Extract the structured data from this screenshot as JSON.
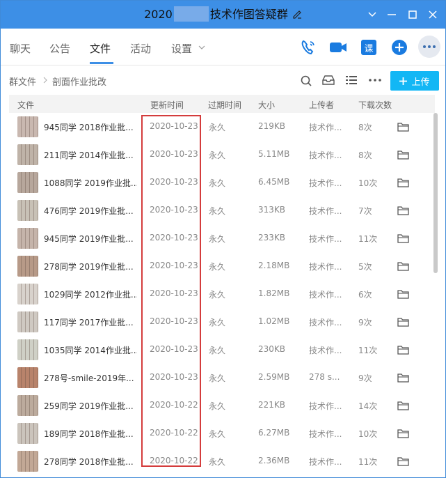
{
  "window": {
    "title_prefix": "2020",
    "title_suffix": "技术作图答疑群"
  },
  "tabs": [
    {
      "label": "聊天"
    },
    {
      "label": "公告"
    },
    {
      "label": "文件"
    },
    {
      "label": "活动"
    },
    {
      "label": "设置"
    }
  ],
  "toolbar": {
    "course_label": "课"
  },
  "breadcrumb": {
    "root": "群文件",
    "current": "剖面作业批改"
  },
  "upload": {
    "label": "上传"
  },
  "columns": {
    "file": "文件",
    "updated": "更新时间",
    "expires": "过期时间",
    "size": "大小",
    "uploader": "上传者",
    "downloads": "下载次数"
  },
  "files": [
    {
      "name": "945同学 2018作业批...",
      "updated": "2020-10-23",
      "expires": "永久",
      "size": "219KB",
      "uploader": "技术作...",
      "downloads": "8次"
    },
    {
      "name": "211同学 2014作业批...",
      "updated": "2020-10-23",
      "expires": "永久",
      "size": "5.11MB",
      "uploader": "技术作...",
      "downloads": "8次"
    },
    {
      "name": "1088同学 2019作业批...",
      "updated": "2020-10-23",
      "expires": "永久",
      "size": "6.45MB",
      "uploader": "技术作...",
      "downloads": "10次"
    },
    {
      "name": "476同学 2019作业批...",
      "updated": "2020-10-23",
      "expires": "永久",
      "size": "313KB",
      "uploader": "技术作...",
      "downloads": "7次"
    },
    {
      "name": "945同学 2019作业批...",
      "updated": "2020-10-23",
      "expires": "永久",
      "size": "233KB",
      "uploader": "技术作...",
      "downloads": "11次"
    },
    {
      "name": "278同学 2019作业批...",
      "updated": "2020-10-23",
      "expires": "永久",
      "size": "2.18MB",
      "uploader": "技术作...",
      "downloads": "5次"
    },
    {
      "name": "1029同学 2012作业批...",
      "updated": "2020-10-23",
      "expires": "永久",
      "size": "1.82MB",
      "uploader": "技术作...",
      "downloads": "6次"
    },
    {
      "name": "117同学 2017作业批...",
      "updated": "2020-10-23",
      "expires": "永久",
      "size": "1.02MB",
      "uploader": "技术作...",
      "downloads": "9次"
    },
    {
      "name": "1035同学 2014作业批...",
      "updated": "2020-10-23",
      "expires": "永久",
      "size": "230KB",
      "uploader": "技术作...",
      "downloads": "11次"
    },
    {
      "name": "278号-smile-2019年...",
      "updated": "2020-10-23",
      "expires": "永久",
      "size": "2.59MB",
      "uploader": "278 s...",
      "downloads": "9次"
    },
    {
      "name": "259同学 2019作业批...",
      "updated": "2020-10-22",
      "expires": "永久",
      "size": "221KB",
      "uploader": "技术作...",
      "downloads": "14次"
    },
    {
      "name": "189同学 2018作业批...",
      "updated": "2020-10-22",
      "expires": "永久",
      "size": "6.27MB",
      "uploader": "技术作...",
      "downloads": "10次"
    },
    {
      "name": "278同学 2018作业批...",
      "updated": "2020-10-22",
      "expires": "永久",
      "size": "2.36MB",
      "uploader": "技术作...",
      "downloads": "11次"
    }
  ],
  "thumb_colors": [
    "#c9b8b0",
    "#bfb3a8",
    "#b7a79c",
    "#c8c1b6",
    "#c5b4aa",
    "#b79a88",
    "#d8d2cc",
    "#cfc9c2",
    "#cfd0c6",
    "#b8836b",
    "#bcab9d",
    "#cbc4bc",
    "#c2a896"
  ]
}
